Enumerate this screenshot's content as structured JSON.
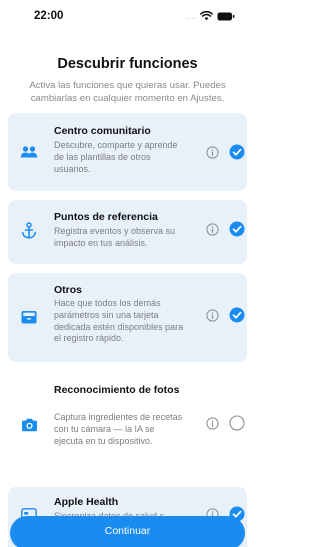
{
  "status_bar": {
    "time": "22:00",
    "signal": "....",
    "icons": [
      "wifi-icon",
      "battery-icon"
    ]
  },
  "header": {
    "title": "Descubrir funciones",
    "subtitle": "Activa las funciones que quieras usar. Puedes cambiarlas en cualquier momento en Ajustes."
  },
  "features": [
    {
      "title": "Centro comunitario",
      "description": "Descubre, comparte y aprende de las plantillas de otros usuarios.",
      "icon": "people-icon",
      "selected": true
    },
    {
      "title": "Puntos de referencia",
      "description": "Registra eventos y observa su impacto en tus análisis.",
      "icon": "anchor-icon",
      "selected": true
    },
    {
      "title": "Otros",
      "description": "Hace que todos los demás parámetros sin una tarjeta dedicada estén disponibles para el registro rápido.",
      "icon": "tray-icon",
      "selected": true
    },
    {
      "title": "Reconocimiento de fotos",
      "description": "Captura ingredientes de recetas con tu cámara — la IA se ejecuta en tu dispositivo.",
      "icon": "camera-icon",
      "selected": false
    },
    {
      "title": "Apple Health",
      "description": "Sincroniza datos de salud c...",
      "icon": "health-card-icon",
      "selected": true
    }
  ],
  "footer": {
    "continue_label": "Continuar"
  },
  "colors": {
    "accent": "#1a8cf0",
    "selected_card_bg": "#e8f0fa",
    "secondary_text": "#7d7d82"
  }
}
